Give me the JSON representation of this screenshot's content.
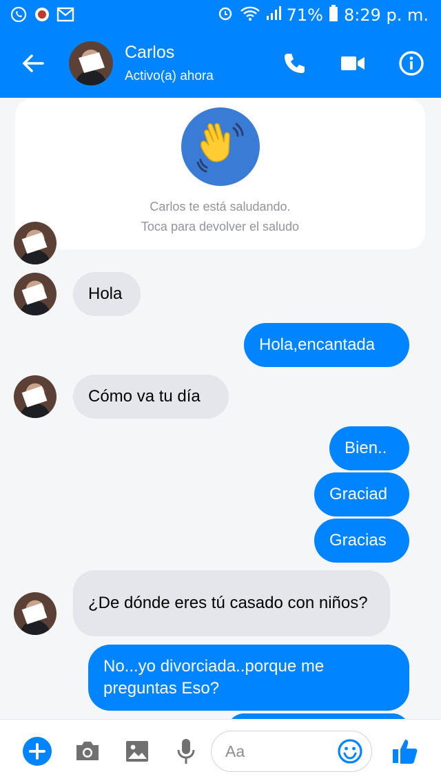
{
  "status_bar": {
    "battery": "71%",
    "time": "8:29 p. m."
  },
  "header": {
    "name": "Carlos",
    "status": "Activo(a) ahora"
  },
  "wave_card": {
    "line1": "Carlos te está saludando.",
    "line2": "Toca para devolver el saludo"
  },
  "messages": [
    {
      "from": "in",
      "text": "Hola"
    },
    {
      "from": "out",
      "text": "Hola,encantada"
    },
    {
      "from": "in",
      "text": "Cómo va tu día"
    },
    {
      "from": "out",
      "text": "Bien.."
    },
    {
      "from": "out",
      "text": "Graciad"
    },
    {
      "from": "out",
      "text": "Gracias"
    },
    {
      "from": "in",
      "text": "¿De dónde eres tú casado con niños?"
    },
    {
      "from": "out",
      "text": "No...yo divorciada..porque me preguntas Eso?"
    }
  ],
  "composer": {
    "placeholder": "Aa"
  },
  "colors": {
    "brand": "#0084ff",
    "incoming_bubble": "#e4e6eb"
  },
  "icons": [
    "whatsapp-icon",
    "app-icon",
    "mail-icon",
    "alarm-icon",
    "wifi-icon",
    "signal-icon",
    "battery-icon",
    "back-arrow-icon",
    "phone-icon",
    "video-icon",
    "info-icon",
    "wave-hand-icon",
    "plus-icon",
    "camera-icon",
    "image-icon",
    "microphone-icon",
    "emoji-icon",
    "thumbs-up-icon"
  ]
}
